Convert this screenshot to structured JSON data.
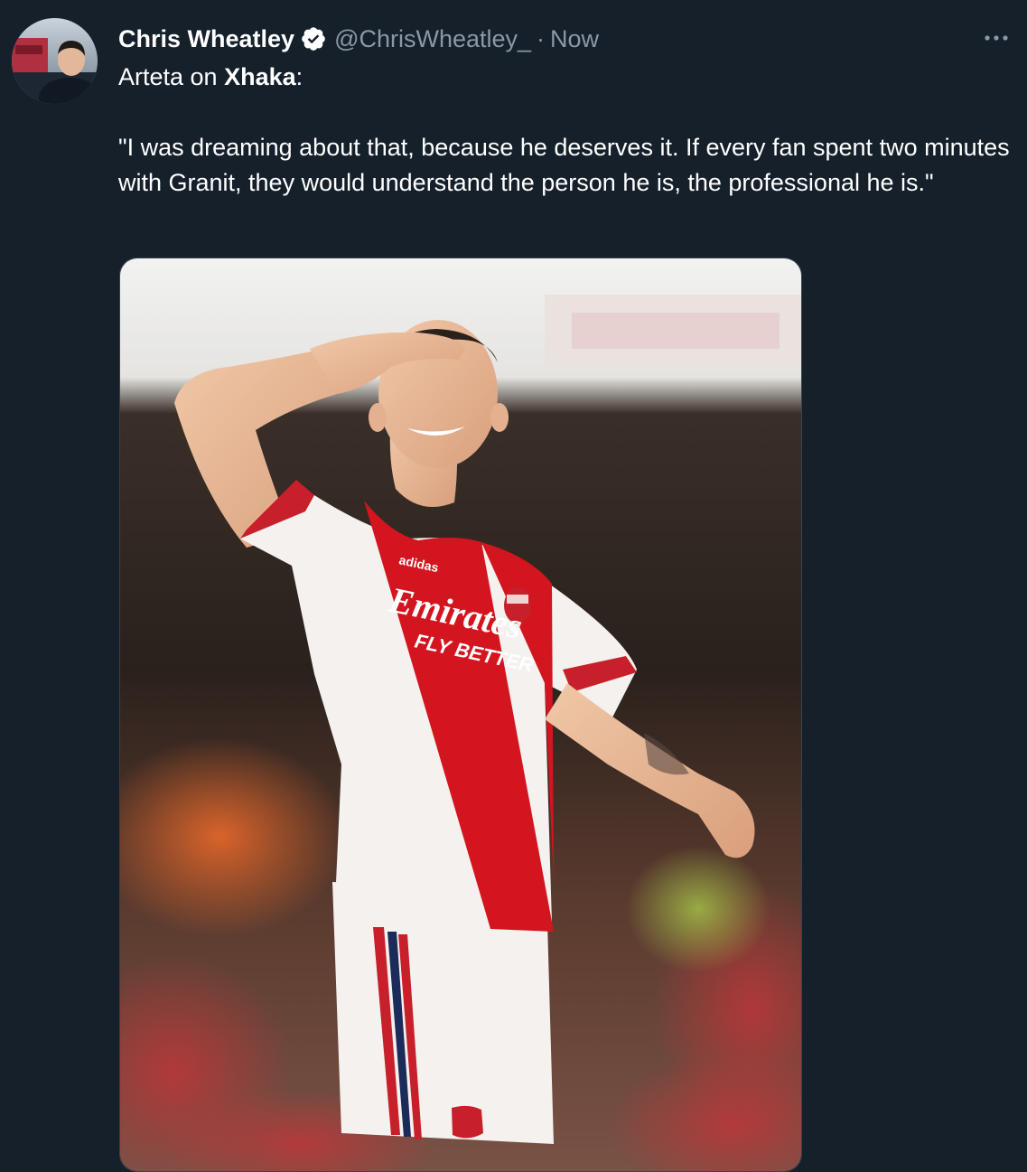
{
  "tweet": {
    "author_name": "Chris Wheatley",
    "handle": "@ChrisWheatley_",
    "separator": "·",
    "timestamp": "Now",
    "more_icon": "more-horizontal-icon",
    "verified_icon": "verified-badge-icon",
    "text_intro": "Arteta on ",
    "text_intro_bold": "Xhaka",
    "text_intro_end": ":",
    "quote": "\"I was dreaming about that, because he deserves it. If every fan spent two minutes with Granit, they would understand the person he is, the professional he is.\"",
    "media": {
      "shirt_sponsor_line1": "Emirates",
      "shirt_sponsor_line2": "FLY BETTER",
      "shirt_brand": "adidas"
    }
  },
  "colors": {
    "background": "#15202b",
    "text": "#ffffff",
    "secondary_text": "#8b98a5",
    "arsenal_red": "#d3151f"
  }
}
